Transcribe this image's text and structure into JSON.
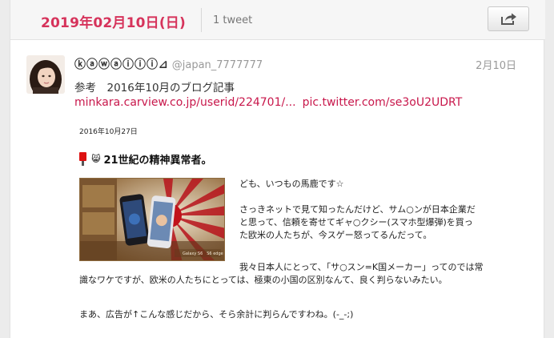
{
  "date_header": {
    "date": "2019年02月10日(日)",
    "count": "1 tweet"
  },
  "share": {
    "icon": "share-icon"
  },
  "tweet": {
    "name": "ⓚⓐⓦⓐⓘⓘⓘ⊿",
    "handle": "@japan_7777777",
    "time": "2月10日",
    "text": "参考　2016年10月のブログ記事",
    "link1": "minkara.carview.co.jp/userid/224701/...",
    "link2": "pic.twitter.com/se3oU2UDRT"
  },
  "photo": {
    "date": "2016年10月27日",
    "emoji": "😸",
    "title": "21世紀の精神異常者。",
    "ad_caption": "Galaxy S6　S6 edge",
    "lines_beside": [
      "ども、いつもの馬鹿です☆",
      "",
      "さっきネットで見て知ったんだけど、サム○ンが日本企業だ",
      "と思って、信頼を寄せてギャ○クシー(スマホ型爆弾)を買っ",
      "た欧米の人たちが、今スゲー怒ってるんだって。",
      ""
    ],
    "lines_wide": [
      "我々日本人にとって、「サ○スン=K国メーカー」ってのでは常",
      "識なワケですが、欧米の人たちにとっては、極東の小国の区別なんて、良く判らないみたい。"
    ],
    "last_line": "まあ、広告が↑こんな感じだから、そら余計に判らんですわね。(-_-;)"
  },
  "colors": {
    "accent": "#d6335b",
    "link": "#c8174b",
    "header_bg": "#f6f6f6"
  }
}
